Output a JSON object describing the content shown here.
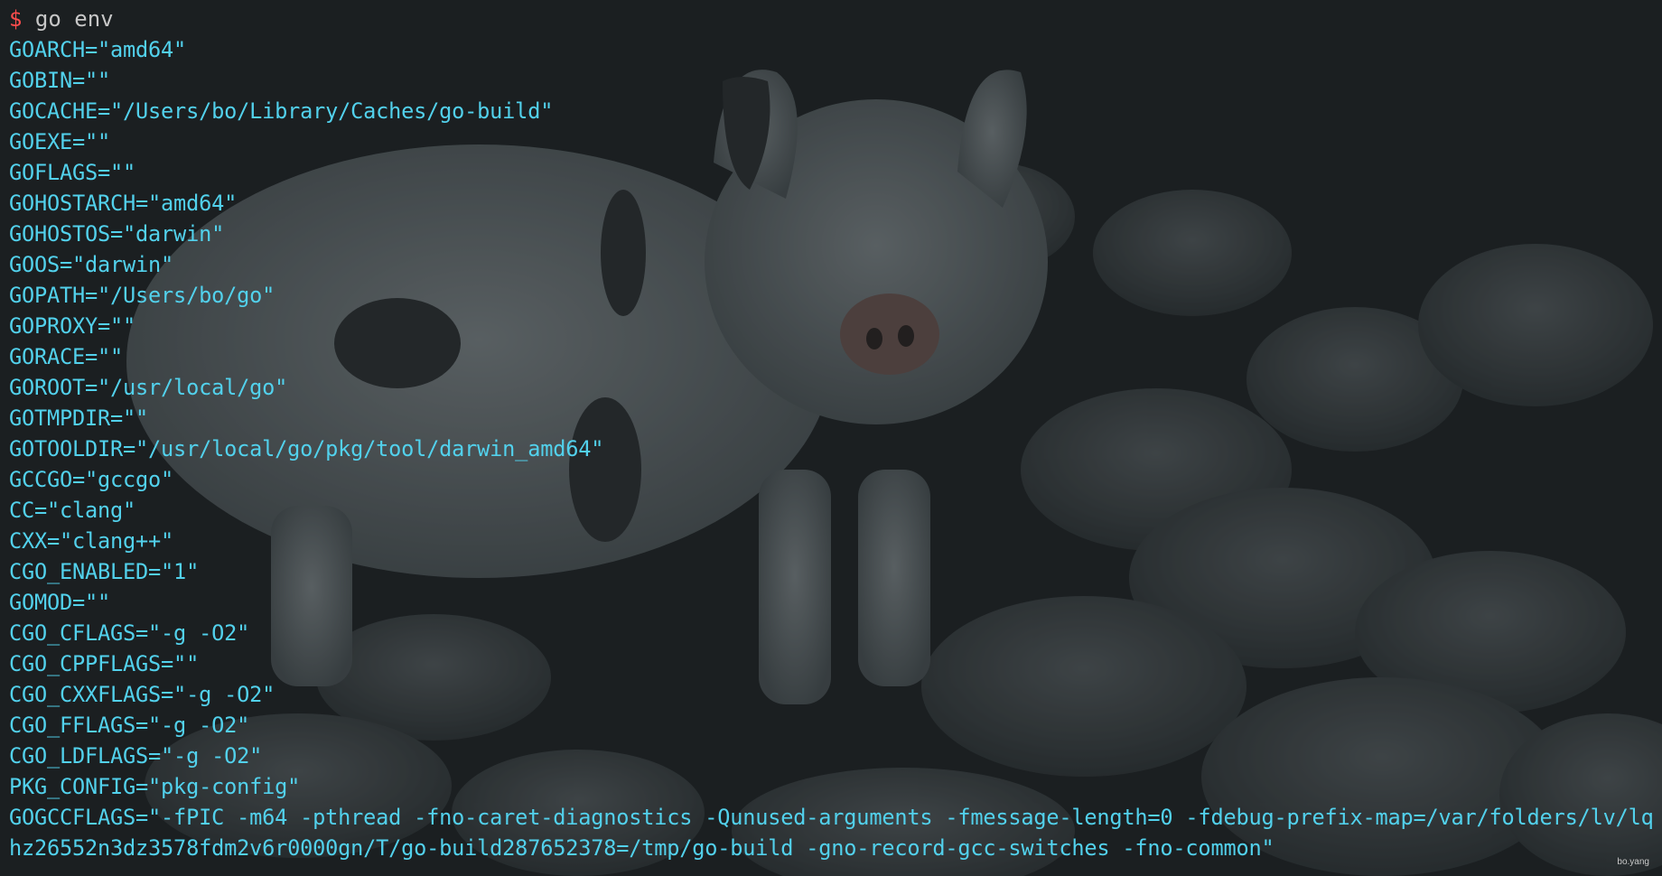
{
  "terminal": {
    "prompt_symbol": "$",
    "command": "go env",
    "env_lines": [
      "GOARCH=\"amd64\"",
      "GOBIN=\"\"",
      "GOCACHE=\"/Users/bo/Library/Caches/go-build\"",
      "GOEXE=\"\"",
      "GOFLAGS=\"\"",
      "GOHOSTARCH=\"amd64\"",
      "GOHOSTOS=\"darwin\"",
      "GOOS=\"darwin\"",
      "GOPATH=\"/Users/bo/go\"",
      "GOPROXY=\"\"",
      "GORACE=\"\"",
      "GOROOT=\"/usr/local/go\"",
      "GOTMPDIR=\"\"",
      "GOTOOLDIR=\"/usr/local/go/pkg/tool/darwin_amd64\"",
      "GCCGO=\"gccgo\"",
      "CC=\"clang\"",
      "CXX=\"clang++\"",
      "CGO_ENABLED=\"1\"",
      "GOMOD=\"\"",
      "CGO_CFLAGS=\"-g -O2\"",
      "CGO_CPPFLAGS=\"\"",
      "CGO_CXXFLAGS=\"-g -O2\"",
      "CGO_FFLAGS=\"-g -O2\"",
      "CGO_LDFLAGS=\"-g -O2\"",
      "PKG_CONFIG=\"pkg-config\"",
      "GOGCCFLAGS=\"-fPIC -m64 -pthread -fno-caret-diagnostics -Qunused-arguments -fmessage-length=0 -fdebug-prefix-map=/var/folders/lv/lq",
      "hz26552n3dz3578fdm2v6r0000gn/T/go-build287652378=/tmp/go-build -gno-record-gcc-switches -fno-common\""
    ]
  },
  "wallpaper": {
    "credit": "bo.yang"
  },
  "colors": {
    "background": "#202427",
    "env_text": "#52d1ec",
    "prompt_symbol": "#ff4d4d",
    "command_text": "#c7c7c7"
  }
}
